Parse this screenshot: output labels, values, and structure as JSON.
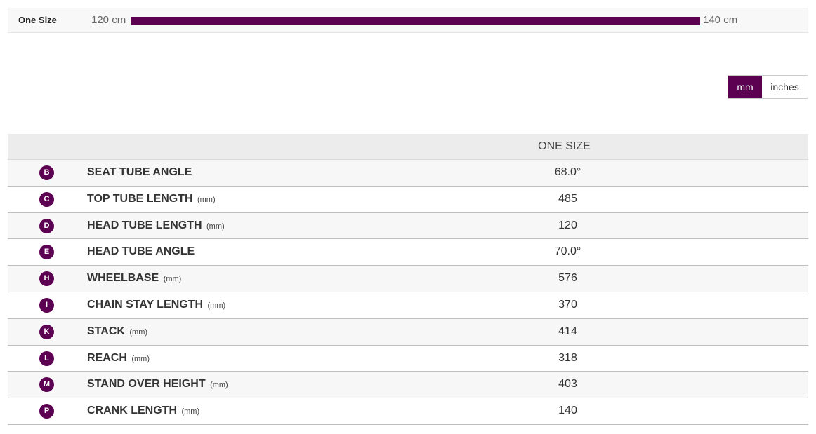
{
  "size_range": {
    "size_name": "One Size",
    "min_label": "120 cm",
    "max_label": "140 cm",
    "fill_fraction": 1.0,
    "accent_color": "#5c0051"
  },
  "units": {
    "mm_label": "mm",
    "inches_label": "inches",
    "selected": "mm"
  },
  "table": {
    "header": "ONE SIZE",
    "rows": [
      {
        "badge": "B",
        "name": "SEAT TUBE ANGLE",
        "unit": "",
        "value": "68.0°"
      },
      {
        "badge": "C",
        "name": "TOP TUBE LENGTH",
        "unit": "(mm)",
        "value": "485"
      },
      {
        "badge": "D",
        "name": "HEAD TUBE LENGTH",
        "unit": "(mm)",
        "value": "120"
      },
      {
        "badge": "E",
        "name": "HEAD TUBE ANGLE",
        "unit": "",
        "value": "70.0°"
      },
      {
        "badge": "H",
        "name": "WHEELBASE",
        "unit": "(mm)",
        "value": "576"
      },
      {
        "badge": "I",
        "name": "CHAIN STAY LENGTH",
        "unit": "(mm)",
        "value": "370"
      },
      {
        "badge": "K",
        "name": "STACK",
        "unit": "(mm)",
        "value": "414"
      },
      {
        "badge": "L",
        "name": "REACH",
        "unit": "(mm)",
        "value": "318"
      },
      {
        "badge": "M",
        "name": "STAND OVER HEIGHT",
        "unit": "(mm)",
        "value": "403"
      },
      {
        "badge": "P",
        "name": "CRANK LENGTH",
        "unit": "(mm)",
        "value": "140"
      }
    ]
  }
}
